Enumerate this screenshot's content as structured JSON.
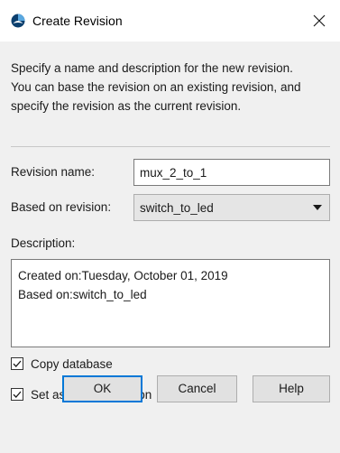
{
  "window": {
    "title": "Create Revision",
    "close_glyph": "✕"
  },
  "intro_text": "Specify a name and description for the new revision. You can base the revision on an existing revision, and specify the revision as the current revision.",
  "fields": {
    "revision_name_label": "Revision name:",
    "revision_name_value": "mux_2_to_1",
    "based_on_label": "Based on revision:",
    "based_on_value": "switch_to_led",
    "description_label": "Description:",
    "description_lines": [
      "Created on:Tuesday, October 01, 2019",
      "Based on:switch_to_led"
    ]
  },
  "options": {
    "copy_database_label": "Copy database",
    "copy_database_checked": true,
    "set_current_label": "Set as current revision",
    "set_current_checked": true
  },
  "buttons": {
    "ok": "OK",
    "cancel": "Cancel",
    "help": "Help"
  },
  "icons": {
    "app": "quartus-app-icon",
    "close": "close-icon",
    "dropdown": "chevron-down-icon",
    "check": "checkmark-icon"
  },
  "colors": {
    "body_bg": "#f0f0f0",
    "accent": "#0078d7",
    "app_icon_dark": "#0c3f6e",
    "app_icon_light": "#5aa8e0"
  }
}
